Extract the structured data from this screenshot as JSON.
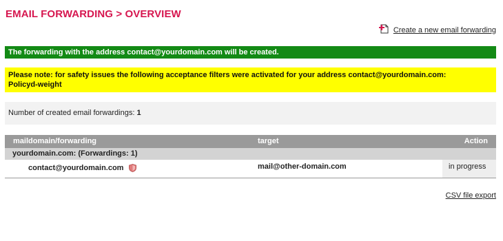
{
  "header": {
    "title": "EMAIL FORWARDING > OVERVIEW",
    "create_link": "Create a new email forwarding",
    "create_icon": "add-document-icon"
  },
  "messages": {
    "success": "The forwarding with the address contact@yourdomain.com will be created.",
    "warning_line1": "Please note: for safety issues the following acceptance filters were activated for your address contact@yourdomain.com:",
    "warning_line2": "Policyd-weight"
  },
  "summary": {
    "label": "Number of created email forwardings: ",
    "count": "1"
  },
  "table": {
    "columns": [
      "maildomain/forwarding",
      "target",
      "Action"
    ],
    "group": "yourdomain.com: (Forwardings: 1)",
    "rows": [
      {
        "address": "contact@yourdomain.com",
        "icon": "shield-icon",
        "target": "mail@other-domain.com",
        "action": "in progress"
      }
    ]
  },
  "footer": {
    "csv_link": "CSV file export"
  },
  "colors": {
    "title": "#d6164f",
    "success_bg": "#138a15",
    "warning_bg": "#ffff00",
    "header_bg": "#9a9a9a",
    "group_bg": "#d3d3d3"
  }
}
